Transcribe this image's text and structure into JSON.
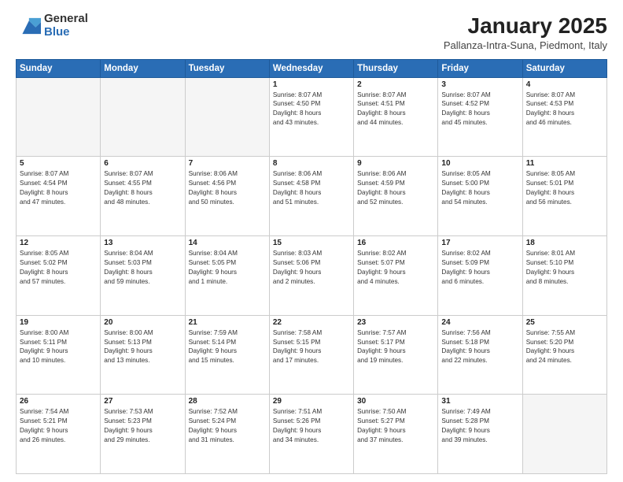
{
  "logo": {
    "general": "General",
    "blue": "Blue"
  },
  "title": "January 2025",
  "subtitle": "Pallanza-Intra-Suna, Piedmont, Italy",
  "days_of_week": [
    "Sunday",
    "Monday",
    "Tuesday",
    "Wednesday",
    "Thursday",
    "Friday",
    "Saturday"
  ],
  "weeks": [
    [
      {
        "day": "",
        "info": ""
      },
      {
        "day": "",
        "info": ""
      },
      {
        "day": "",
        "info": ""
      },
      {
        "day": "1",
        "info": "Sunrise: 8:07 AM\nSunset: 4:50 PM\nDaylight: 8 hours\nand 43 minutes."
      },
      {
        "day": "2",
        "info": "Sunrise: 8:07 AM\nSunset: 4:51 PM\nDaylight: 8 hours\nand 44 minutes."
      },
      {
        "day": "3",
        "info": "Sunrise: 8:07 AM\nSunset: 4:52 PM\nDaylight: 8 hours\nand 45 minutes."
      },
      {
        "day": "4",
        "info": "Sunrise: 8:07 AM\nSunset: 4:53 PM\nDaylight: 8 hours\nand 46 minutes."
      }
    ],
    [
      {
        "day": "5",
        "info": "Sunrise: 8:07 AM\nSunset: 4:54 PM\nDaylight: 8 hours\nand 47 minutes."
      },
      {
        "day": "6",
        "info": "Sunrise: 8:07 AM\nSunset: 4:55 PM\nDaylight: 8 hours\nand 48 minutes."
      },
      {
        "day": "7",
        "info": "Sunrise: 8:06 AM\nSunset: 4:56 PM\nDaylight: 8 hours\nand 50 minutes."
      },
      {
        "day": "8",
        "info": "Sunrise: 8:06 AM\nSunset: 4:58 PM\nDaylight: 8 hours\nand 51 minutes."
      },
      {
        "day": "9",
        "info": "Sunrise: 8:06 AM\nSunset: 4:59 PM\nDaylight: 8 hours\nand 52 minutes."
      },
      {
        "day": "10",
        "info": "Sunrise: 8:05 AM\nSunset: 5:00 PM\nDaylight: 8 hours\nand 54 minutes."
      },
      {
        "day": "11",
        "info": "Sunrise: 8:05 AM\nSunset: 5:01 PM\nDaylight: 8 hours\nand 56 minutes."
      }
    ],
    [
      {
        "day": "12",
        "info": "Sunrise: 8:05 AM\nSunset: 5:02 PM\nDaylight: 8 hours\nand 57 minutes."
      },
      {
        "day": "13",
        "info": "Sunrise: 8:04 AM\nSunset: 5:03 PM\nDaylight: 8 hours\nand 59 minutes."
      },
      {
        "day": "14",
        "info": "Sunrise: 8:04 AM\nSunset: 5:05 PM\nDaylight: 9 hours\nand 1 minute."
      },
      {
        "day": "15",
        "info": "Sunrise: 8:03 AM\nSunset: 5:06 PM\nDaylight: 9 hours\nand 2 minutes."
      },
      {
        "day": "16",
        "info": "Sunrise: 8:02 AM\nSunset: 5:07 PM\nDaylight: 9 hours\nand 4 minutes."
      },
      {
        "day": "17",
        "info": "Sunrise: 8:02 AM\nSunset: 5:09 PM\nDaylight: 9 hours\nand 6 minutes."
      },
      {
        "day": "18",
        "info": "Sunrise: 8:01 AM\nSunset: 5:10 PM\nDaylight: 9 hours\nand 8 minutes."
      }
    ],
    [
      {
        "day": "19",
        "info": "Sunrise: 8:00 AM\nSunset: 5:11 PM\nDaylight: 9 hours\nand 10 minutes."
      },
      {
        "day": "20",
        "info": "Sunrise: 8:00 AM\nSunset: 5:13 PM\nDaylight: 9 hours\nand 13 minutes."
      },
      {
        "day": "21",
        "info": "Sunrise: 7:59 AM\nSunset: 5:14 PM\nDaylight: 9 hours\nand 15 minutes."
      },
      {
        "day": "22",
        "info": "Sunrise: 7:58 AM\nSunset: 5:15 PM\nDaylight: 9 hours\nand 17 minutes."
      },
      {
        "day": "23",
        "info": "Sunrise: 7:57 AM\nSunset: 5:17 PM\nDaylight: 9 hours\nand 19 minutes."
      },
      {
        "day": "24",
        "info": "Sunrise: 7:56 AM\nSunset: 5:18 PM\nDaylight: 9 hours\nand 22 minutes."
      },
      {
        "day": "25",
        "info": "Sunrise: 7:55 AM\nSunset: 5:20 PM\nDaylight: 9 hours\nand 24 minutes."
      }
    ],
    [
      {
        "day": "26",
        "info": "Sunrise: 7:54 AM\nSunset: 5:21 PM\nDaylight: 9 hours\nand 26 minutes."
      },
      {
        "day": "27",
        "info": "Sunrise: 7:53 AM\nSunset: 5:23 PM\nDaylight: 9 hours\nand 29 minutes."
      },
      {
        "day": "28",
        "info": "Sunrise: 7:52 AM\nSunset: 5:24 PM\nDaylight: 9 hours\nand 31 minutes."
      },
      {
        "day": "29",
        "info": "Sunrise: 7:51 AM\nSunset: 5:26 PM\nDaylight: 9 hours\nand 34 minutes."
      },
      {
        "day": "30",
        "info": "Sunrise: 7:50 AM\nSunset: 5:27 PM\nDaylight: 9 hours\nand 37 minutes."
      },
      {
        "day": "31",
        "info": "Sunrise: 7:49 AM\nSunset: 5:28 PM\nDaylight: 9 hours\nand 39 minutes."
      },
      {
        "day": "",
        "info": ""
      }
    ]
  ]
}
